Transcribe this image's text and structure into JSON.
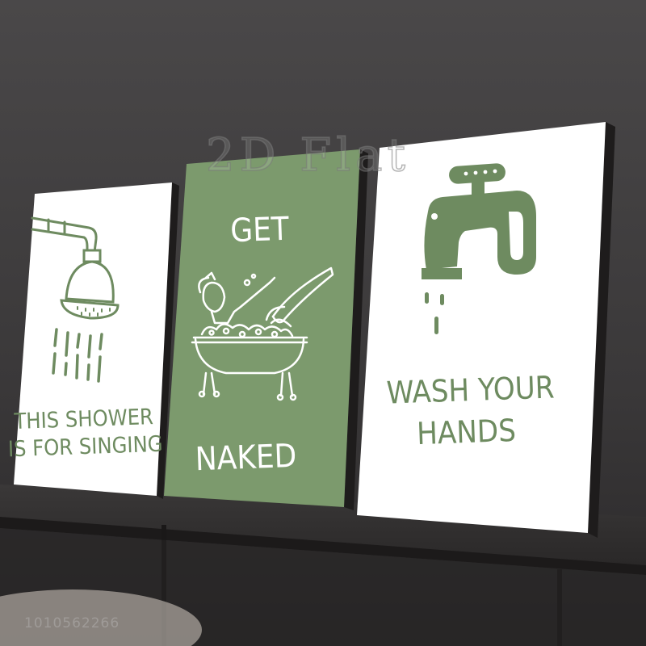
{
  "colors": {
    "wall": "#3e3c3d",
    "poster_green": "#7c9a6d",
    "ink_green": "#6e8b60",
    "poster_white": "#ffffff",
    "frame": "#1e1c1c",
    "shelf": "#2b2929"
  },
  "watermark": "2D Flat",
  "footer_code": "1010562266",
  "posters": [
    {
      "id": "shower",
      "icon": "shower-head-icon",
      "lines": [
        "THIS SHOWER",
        "IS FOR SINGING"
      ]
    },
    {
      "id": "bath",
      "icon": "bathtub-woman-icon",
      "top_text": "GET",
      "bottom_text": "NAKED"
    },
    {
      "id": "faucet",
      "icon": "faucet-icon",
      "lines": [
        "WASH YOUR",
        "HANDS"
      ]
    }
  ]
}
